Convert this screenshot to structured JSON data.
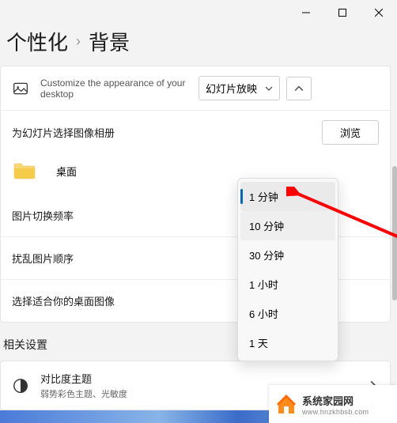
{
  "titlebar": {
    "min": "minimize",
    "max": "maximize",
    "close": "close"
  },
  "breadcrumb": {
    "parent": "个性化",
    "current": "背景"
  },
  "bgSection": {
    "desc": "Customize the appearance of your desktop",
    "comboValue": "幻灯片放映"
  },
  "album": {
    "label": "为幻灯片选择图像相册",
    "browse": "浏览"
  },
  "folder": {
    "name": "桌面"
  },
  "interval": {
    "label": "图片切换频率"
  },
  "shuffle": {
    "label": "扰乱图片顺序"
  },
  "fit": {
    "label": "选择适合你的桌面图像"
  },
  "relatedTitle": "相关设置",
  "contrast": {
    "title": "对比度主题",
    "sub": "弱势彩色主题、光敏度"
  },
  "dropdown": {
    "options": [
      "1 分钟",
      "10 分钟",
      "30 分钟",
      "1 小时",
      "6 小时",
      "1 天"
    ],
    "selectedIndex": 0
  },
  "watermark": {
    "title": "系统家园网",
    "url": "www.hnzkhbsb.com"
  }
}
